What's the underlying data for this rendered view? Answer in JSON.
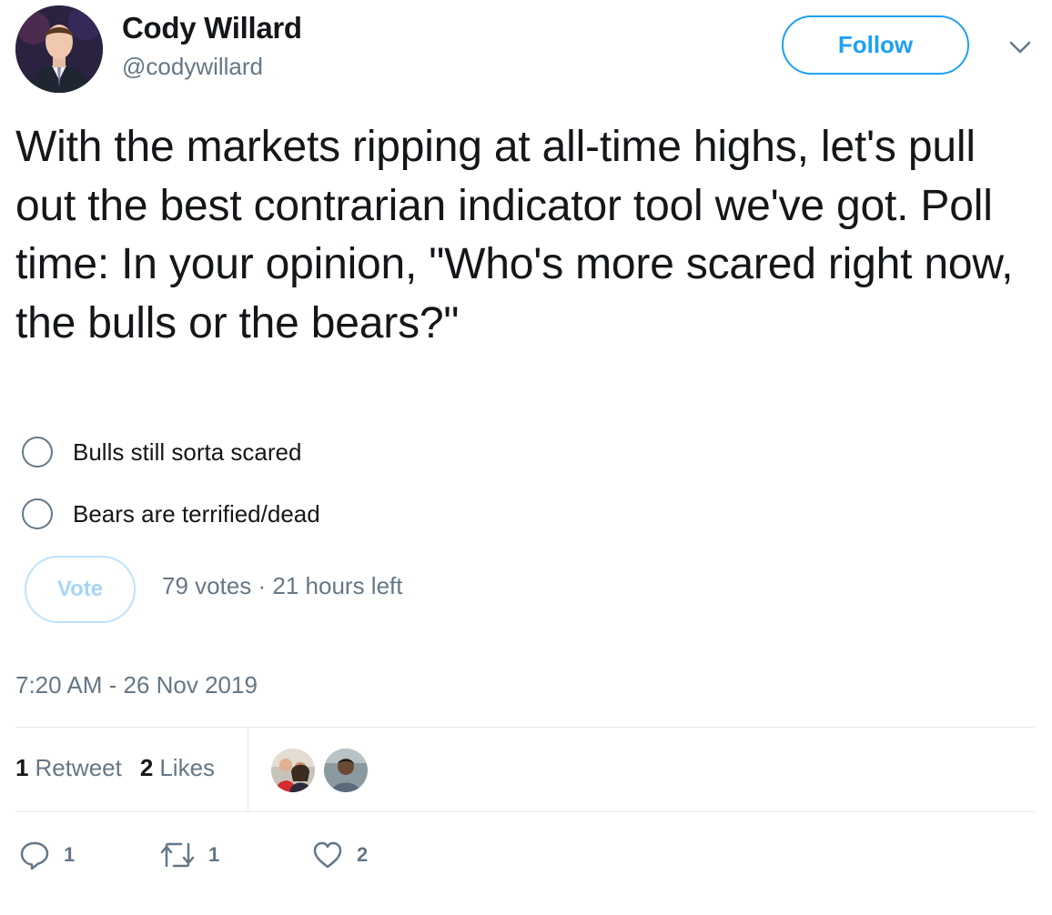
{
  "author": {
    "name": "Cody Willard",
    "handle": "@codywillard"
  },
  "follow_label": "Follow",
  "tweet": {
    "text": "With the markets ripping at all-time highs, let's pull out the best contrarian indicator tool we've got. Poll time: In your opinion, \"Who's more scared right now, the bulls or the bears?\""
  },
  "poll": {
    "options": [
      {
        "label": "Bulls still sorta scared"
      },
      {
        "label": "Bears are terrified/dead"
      }
    ],
    "vote_label": "Vote",
    "meta": "79 votes · 21 hours left"
  },
  "timestamp": "7:20 AM - 26 Nov 2019",
  "stats": {
    "retweets_count": "1",
    "retweets_label": "Retweet",
    "likes_count": "2",
    "likes_label": "Likes"
  },
  "actions": {
    "reply_count": "1",
    "retweet_count": "1",
    "like_count": "2"
  },
  "colors": {
    "accent": "#1da1f2",
    "muted": "#657786",
    "text": "#14171a",
    "border": "#e1e8ed"
  },
  "icons": [
    "avatar",
    "chevron-down-icon",
    "radio-icon",
    "reply-icon",
    "retweet-icon",
    "heart-icon"
  ]
}
